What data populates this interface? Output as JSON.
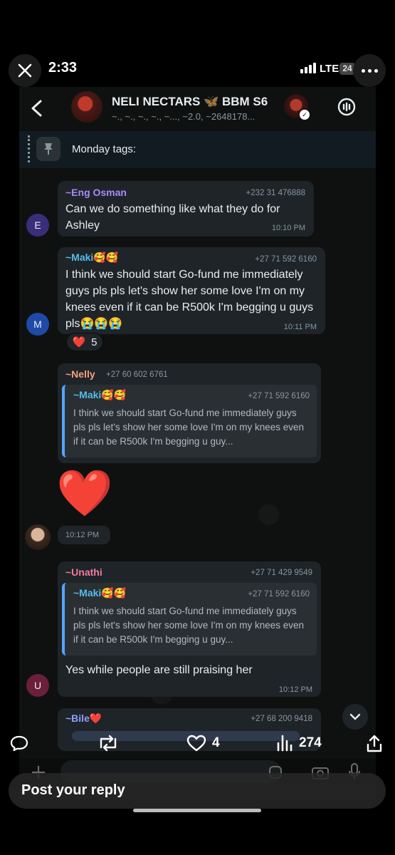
{
  "outer": {
    "time": "2:33",
    "network": "LTE",
    "battery": "24"
  },
  "chat": {
    "title": "NELI NECTARS 🦋 BBM S6",
    "subtitle": "~., ~., ~., ~., ~..., ~2.0, ~2648178...",
    "pinned": "Monday tags:"
  },
  "messages": [
    {
      "sender": "~Eng Osman",
      "phone": "+232 31 476888",
      "text": "Can we do something like what they do for Ashley",
      "time": "10:10 PM",
      "avatar": "E"
    },
    {
      "sender": "~Maki🥰🥰",
      "phone": "+27 71 592 6160",
      "text": "I think we should start Go-fund me immediately guys pls pls let's show her some love I'm on my knees even if it can be R500k I'm begging u guys pls😭😭😭",
      "time": "10:11 PM",
      "avatar": "M",
      "reaction_emoji": "❤️",
      "reaction_count": "5"
    },
    {
      "sender": "~Nelly",
      "phone": "+27 60 602 6761",
      "quote_sender": "~Maki🥰🥰",
      "quote_phone": "+27 71 592 6160",
      "quote_text": "I think we should start Go-fund me immediately guys pls pls let's show her some love I'm on my knees even if it can be R500k I'm begging u guy...",
      "sticker": "❤️",
      "time": "10:12 PM"
    },
    {
      "sender": "~Unathi",
      "phone": "+27 71 429 9549",
      "quote_sender": "~Maki🥰🥰",
      "quote_phone": "+27 71 592 6160",
      "quote_text": "I think we should start Go-fund me immediately guys pls pls let's show her some love I'm on my knees even if it can be R500k I'm begging u guy...",
      "text": "Yes while people are still  praising her",
      "time": "10:12 PM",
      "avatar": "U"
    },
    {
      "sender": "~Bile❤️",
      "phone": "+27 68 200 9418"
    }
  ],
  "actions": {
    "likes": "4",
    "views": "274"
  },
  "reply": {
    "placeholder": "Post your reply"
  },
  "colors": {
    "sender_osman": "#a78bfa",
    "sender_maki": "#53bdeb",
    "sender_nelly": "#f4a27a",
    "sender_unathi": "#f07b9a",
    "sender_bile": "#8ea0ff",
    "avatar_e": "#3a2e7a",
    "avatar_m": "#1f4aa8",
    "avatar_u": "#6b1f3a"
  }
}
